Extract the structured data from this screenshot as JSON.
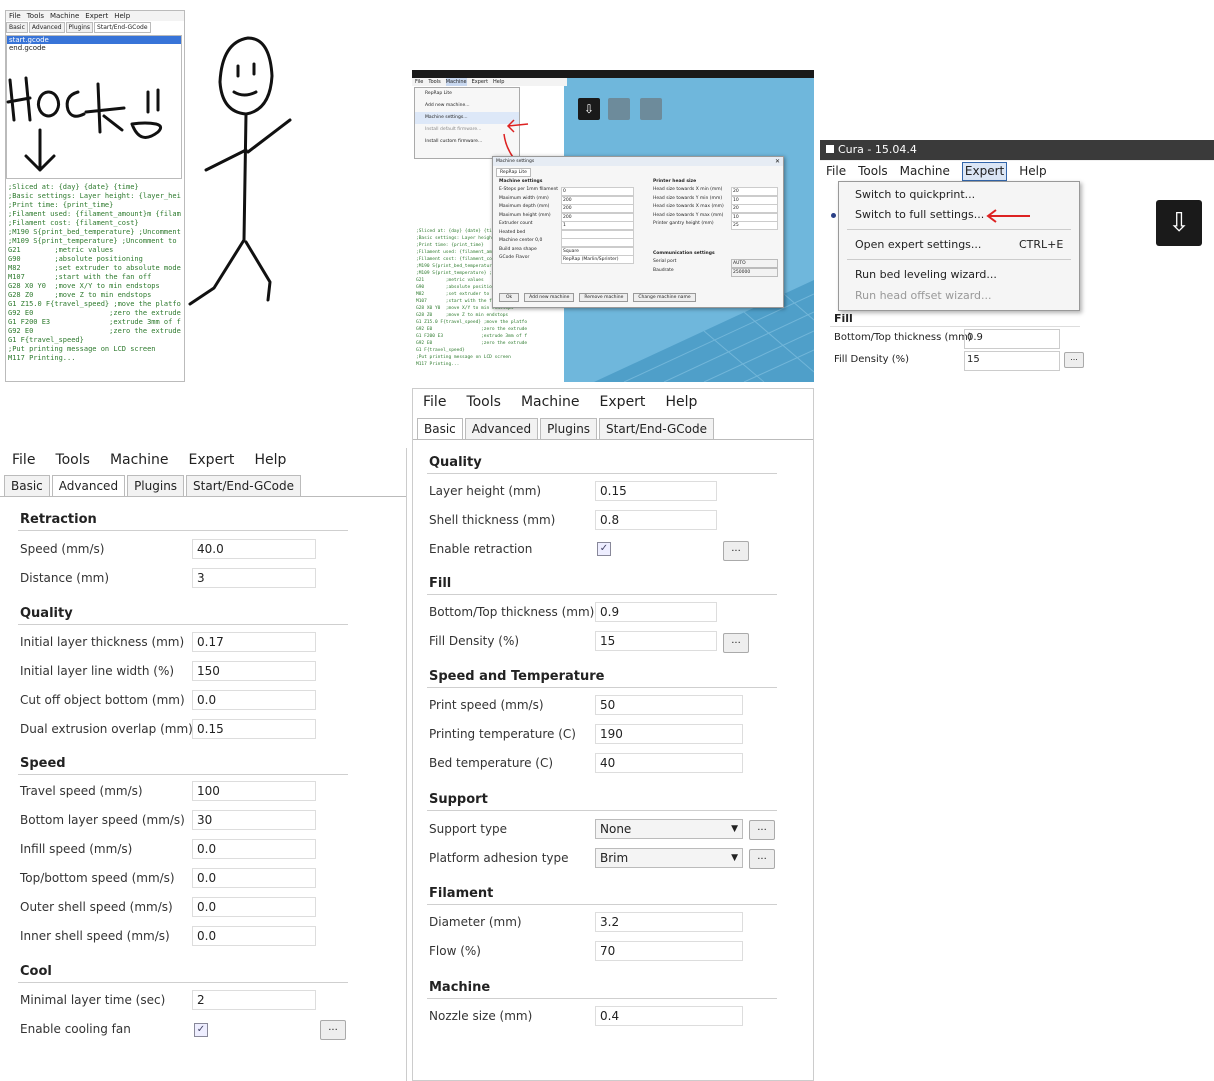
{
  "p1": {
    "menu": [
      "File",
      "Tools",
      "Machine",
      "Expert",
      "Help"
    ],
    "tabs": [
      "Basic",
      "Advanced",
      "Plugins",
      "Start/End-GCode"
    ],
    "files": [
      "start.gcode",
      "end.gcode"
    ],
    "code_lines": [
      ";Sliced at: {day} {date} {time}",
      ";Basic settings: Layer height: {layer_hei",
      ";Print time: {print_time}",
      ";Filament used: {filament_amount}m {filam",
      ";Filament cost: {filament_cost}",
      ";M190 S{print_bed_temperature} ;Uncomment",
      ";M109 S{print_temperature} ;Uncomment to",
      "G21        ;metric values",
      "G90        ;absolute positioning",
      "M82        ;set extruder to absolute mode",
      "M107       ;start with the fan off",
      "G28 X0 Y0  ;move X/Y to min endstops",
      "G28 Z0     ;move Z to min endstops",
      "G1 Z15.0 F{travel_speed} ;move the platfo",
      "G92 E0                  ;zero the extrude",
      "G1 F200 E3              ;extrude 3mm of f",
      "G92 E0                  ;zero the extrude",
      "G1 F{travel_speed}",
      ";Put printing message on LCD screen",
      "M117 Printing..."
    ]
  },
  "p2": {
    "menu": [
      "File",
      "Tools",
      "Machine",
      "Expert",
      "Help"
    ],
    "menu_items": [
      "RepRap Lite",
      "Add new machine...",
      "Machine settings...",
      "Install default firmware...",
      "Install custom firmware..."
    ],
    "dialog_title": "Machine settings",
    "dialog_tab": "RepRap Lite",
    "dialog_left_title": "Machine settings",
    "dialog_left_labels": [
      "E-Steps per 1mm filament",
      "Maximum width (mm)",
      "Maximum depth (mm)",
      "Maximum height (mm)",
      "Extruder count",
      "Heated bed",
      "Machine center 0,0",
      "Build area shape",
      "GCode Flavor"
    ],
    "dialog_left_values": [
      "0",
      "200",
      "200",
      "200",
      "1",
      "",
      "",
      "Square",
      "RepRap (Marlin/Sprinter)"
    ],
    "dialog_right_title": "Printer head size",
    "dialog_right_labels": [
      "Head size towards X min (mm)",
      "Head size towards Y min (mm)",
      "Head size towards X max (mm)",
      "Head size towards Y max (mm)",
      "Printer gantry height (mm)"
    ],
    "dialog_right_values": [
      "20",
      "10",
      "20",
      "10",
      "25"
    ],
    "comm_title": "Communication settings",
    "comm_labels": [
      "Serial port",
      "Baudrate"
    ],
    "comm_values": [
      "AUTO",
      "250000"
    ],
    "buttons": [
      "Ok",
      "Add new machine",
      "Remove machine",
      "Change machine name"
    ]
  },
  "p3": {
    "title": "Cura - 15.04.4",
    "menu": [
      "File",
      "Tools",
      "Machine",
      "Expert",
      "Help"
    ],
    "items": [
      "Switch to quickprint...",
      "Switch to full settings...",
      "Open expert settings...",
      "Run bed leveling wizard...",
      "Run head offset wizard..."
    ],
    "shortcut": "CTRL+E",
    "fill": "Fill",
    "labels": [
      "Bottom/Top thickness (mm)",
      "Fill Density (%)"
    ],
    "values": [
      "0.9",
      "15"
    ]
  },
  "p4": {
    "menu": [
      "File",
      "Tools",
      "Machine",
      "Expert",
      "Help"
    ],
    "tabs": [
      "Basic",
      "Advanced",
      "Plugins",
      "Start/End-GCode"
    ],
    "sections": [
      "Retraction",
      "Quality",
      "Speed",
      "Cool"
    ],
    "retraction": {
      "labels": [
        "Speed (mm/s)",
        "Distance (mm)"
      ],
      "values": [
        "40.0",
        "3"
      ]
    },
    "quality": {
      "labels": [
        "Initial layer thickness (mm)",
        "Initial layer line width (%)",
        "Cut off object bottom (mm)",
        "Dual extrusion overlap (mm)"
      ],
      "values": [
        "0.17",
        "150",
        "0.0",
        "0.15"
      ]
    },
    "speed": {
      "labels": [
        "Travel speed (mm/s)",
        "Bottom layer speed (mm/s)",
        "Infill speed (mm/s)",
        "Top/bottom speed (mm/s)",
        "Outer shell speed (mm/s)",
        "Inner shell speed (mm/s)"
      ],
      "values": [
        "100",
        "30",
        "0.0",
        "0.0",
        "0.0",
        "0.0"
      ]
    },
    "cool": {
      "labels": [
        "Minimal layer time (sec)",
        "Enable cooling fan"
      ],
      "values": [
        "2"
      ]
    }
  },
  "p5": {
    "menu": [
      "File",
      "Tools",
      "Machine",
      "Expert",
      "Help"
    ],
    "tabs": [
      "Basic",
      "Advanced",
      "Plugins",
      "Start/End-GCode"
    ],
    "sections": [
      "Quality",
      "Fill",
      "Speed and Temperature",
      "Support",
      "Filament",
      "Machine"
    ],
    "quality": {
      "labels": [
        "Layer height (mm)",
        "Shell thickness (mm)",
        "Enable retraction"
      ],
      "values": [
        "0.15",
        "0.8"
      ]
    },
    "fill": {
      "labels": [
        "Bottom/Top thickness (mm)",
        "Fill Density (%)"
      ],
      "values": [
        "0.9",
        "15"
      ]
    },
    "speed": {
      "labels": [
        "Print speed (mm/s)",
        "Printing temperature (C)",
        "Bed temperature (C)"
      ],
      "values": [
        "50",
        "190",
        "40"
      ]
    },
    "support": {
      "labels": [
        "Support type",
        "Platform adhesion type"
      ],
      "values": [
        "None",
        "Brim"
      ]
    },
    "filament": {
      "labels": [
        "Diameter (mm)",
        "Flow (%)"
      ],
      "values": [
        "3.2",
        "70"
      ]
    },
    "machine": {
      "labels": [
        "Nozzle size (mm)"
      ],
      "values": [
        "0.4"
      ]
    }
  }
}
